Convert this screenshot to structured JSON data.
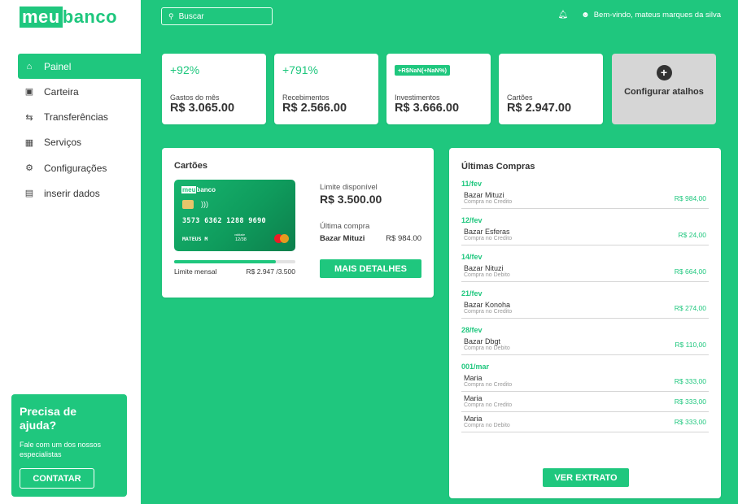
{
  "brand": {
    "prefix": "meu",
    "suffix": "banco"
  },
  "sidebar": {
    "items": [
      {
        "label": "Painel",
        "icon": "home-icon"
      },
      {
        "label": "Carteira",
        "icon": "wallet-icon"
      },
      {
        "label": "Transferências",
        "icon": "transfer-icon"
      },
      {
        "label": "Serviços",
        "icon": "grid-icon"
      },
      {
        "label": "Configurações",
        "icon": "gear-icon"
      },
      {
        "label": "inserir dados",
        "icon": "document-icon"
      }
    ],
    "help": {
      "title": "Precisa de ajuda?",
      "text": "Fale com um dos nossos especialistas",
      "button": "CONTATAR"
    }
  },
  "header": {
    "search_placeholder": "Buscar",
    "welcome": "Bem-vindo, mateus marques da silva"
  },
  "stats": [
    {
      "change": "+92%",
      "label": "Gastos do mês",
      "value": "R$ 3.065.00"
    },
    {
      "change": "+791%",
      "label": "Recebimentos",
      "value": "R$ 2.566.00"
    },
    {
      "badge": "+R$NaN(+NaN%)",
      "label": "Investimentos",
      "value": "R$ 3.666.00"
    },
    {
      "change": "",
      "label": "Cartões",
      "value": "R$ 2.947.00"
    }
  ],
  "shortcuts": {
    "label": "Configurar atalhos"
  },
  "cards_panel": {
    "title": "Cartões",
    "card": {
      "brand_prefix": "meu",
      "brand_suffix": "banco",
      "number": "3573 6362 1288 9690",
      "holder": "MATEUS M",
      "valid_label": "validade",
      "valid_date": "12/38"
    },
    "limit_label": "Limite mensal",
    "limit_value": "R$ 2.947 /3.500",
    "limit_used_fraction": 0.842,
    "available_label": "Limite disponível",
    "available_value": "R$ 3.500.00",
    "last_label": "Última compra",
    "last_store": "Bazar Mituzi",
    "last_amount": "R$ 984.00",
    "details_button": "MAIS DETALHES"
  },
  "purchases_panel": {
    "title": "Últimas Compras",
    "groups": [
      {
        "date": "11/fev",
        "items": [
          {
            "store": "Bazar Mituzi",
            "type": "Compra no Credito",
            "amount": "R$ 984,00"
          }
        ]
      },
      {
        "date": "12/fev",
        "items": [
          {
            "store": "Bazar Esferas",
            "type": "Compra no Credito",
            "amount": "R$ 24,00"
          }
        ]
      },
      {
        "date": "14/fev",
        "items": [
          {
            "store": "Bazar Nituzi",
            "type": "Compra no Debito",
            "amount": "R$ 664,00"
          }
        ]
      },
      {
        "date": "21/fev",
        "items": [
          {
            "store": "Bazar Konoha",
            "type": "Compra no Credito",
            "amount": "R$ 274,00"
          }
        ]
      },
      {
        "date": "28/fev",
        "items": [
          {
            "store": "Bazar Dbgt",
            "type": "Compra no Debito",
            "amount": "R$ 110,00"
          }
        ]
      },
      {
        "date": "001/mar",
        "items": [
          {
            "store": "Maria",
            "type": "Compra no Credito",
            "amount": "R$ 333,00"
          },
          {
            "store": "Maria",
            "type": "Compra no Credito",
            "amount": "R$ 333,00"
          },
          {
            "store": "Maria",
            "type": "Compra no Debito",
            "amount": "R$ 333,00"
          }
        ]
      }
    ],
    "statement_button": "VER EXTRATO"
  },
  "colors": {
    "accent": "#1fc77e",
    "card_dark": "#0d7f4c",
    "shortcut_bg": "#d6d6d6"
  }
}
